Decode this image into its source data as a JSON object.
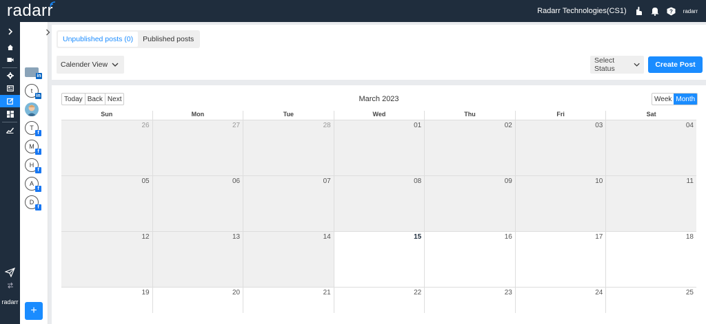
{
  "header": {
    "logo_text": "radarr",
    "org_name": "Radarr Technologies(CS1)",
    "mini_logo": "radarr",
    "icons": [
      "hand-pointer-icon",
      "bell-icon",
      "help-icon"
    ]
  },
  "rail": {
    "items": [
      "expand-icon",
      "home-icon",
      "video-icon",
      "settings-icon",
      "news-icon",
      "publish-icon",
      "dashboard-icon",
      "analytics-icon"
    ],
    "bottom_items": [
      "send-icon",
      "switch-icon"
    ],
    "brand": "radarr"
  },
  "accounts": [
    {
      "letter": "",
      "network": "linkedin",
      "type": "image"
    },
    {
      "letter": "t",
      "network": "linkedin",
      "type": "letter"
    },
    {
      "letter": "",
      "network": "",
      "type": "photo"
    },
    {
      "letter": "T",
      "network": "facebook",
      "type": "letter"
    },
    {
      "letter": "M",
      "network": "facebook",
      "type": "letter"
    },
    {
      "letter": "H",
      "network": "facebook",
      "type": "letter"
    },
    {
      "letter": "A",
      "network": "facebook",
      "type": "letter"
    },
    {
      "letter": "D",
      "network": "facebook",
      "type": "letter"
    }
  ],
  "add_button": "+",
  "tabs": [
    {
      "label": "Unpublished posts (0)",
      "active": true
    },
    {
      "label": "Published posts",
      "active": false
    }
  ],
  "view_select": "Calender View",
  "status_select": "Select Status",
  "create_button": "Create Post",
  "calendar": {
    "nav": {
      "today": "Today",
      "back": "Back",
      "next": "Next"
    },
    "title": "March 2023",
    "views": {
      "week": "Week",
      "month": "Month",
      "active": "Month"
    },
    "weekdays": [
      "Sun",
      "Mon",
      "Tue",
      "Wed",
      "Thu",
      "Fri",
      "Sat"
    ],
    "weeks": [
      [
        "26",
        "27",
        "28",
        "01",
        "02",
        "03",
        "04"
      ],
      [
        "05",
        "06",
        "07",
        "08",
        "09",
        "10",
        "11"
      ],
      [
        "12",
        "13",
        "14",
        "15",
        "16",
        "17",
        "18"
      ],
      [
        "19",
        "20",
        "21",
        "22",
        "23",
        "24",
        "25"
      ]
    ],
    "today": "15",
    "colors": {
      "accent": "#1a8cff",
      "past_bg": "#f0f0f0",
      "topbar": "#1f2d3d"
    }
  }
}
